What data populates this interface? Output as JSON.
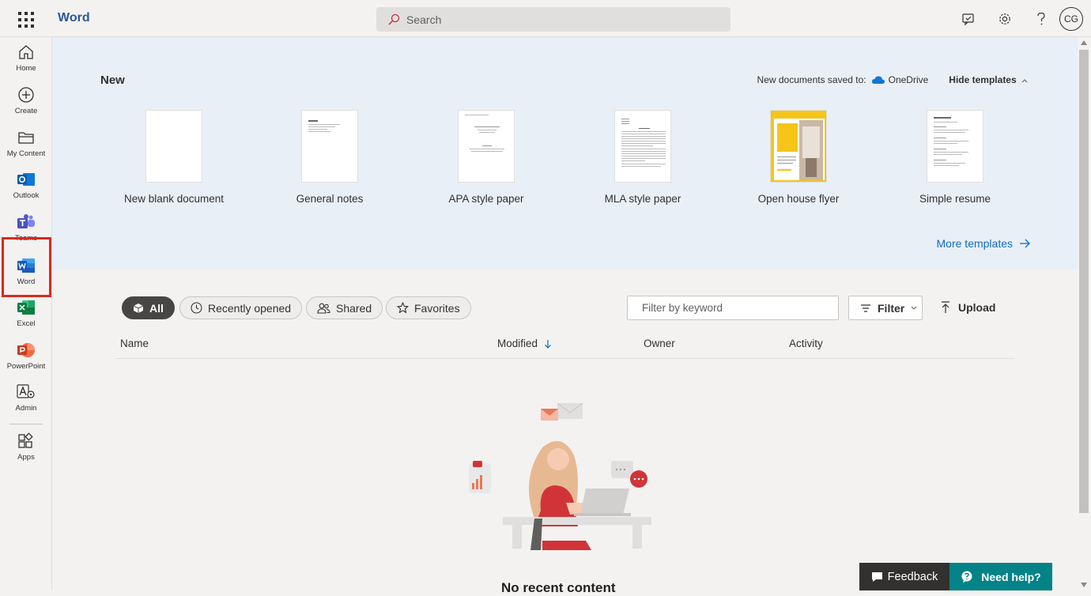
{
  "topbar": {
    "app_name": "Word",
    "search_placeholder": "Search",
    "avatar_initials": "CG"
  },
  "rail": {
    "items": [
      {
        "label": "Home",
        "icon": "home-icon"
      },
      {
        "label": "Create",
        "icon": "plus-circle-icon"
      },
      {
        "label": "My Content",
        "icon": "folder-icon"
      },
      {
        "label": "Outlook",
        "icon": "outlook-icon"
      },
      {
        "label": "Teams",
        "icon": "teams-icon"
      },
      {
        "label": "Word",
        "icon": "word-icon"
      },
      {
        "label": "Excel",
        "icon": "excel-icon"
      },
      {
        "label": "PowerPoint",
        "icon": "powerpoint-icon"
      },
      {
        "label": "Admin",
        "icon": "admin-icon"
      },
      {
        "label": "Apps",
        "icon": "apps-icon"
      }
    ]
  },
  "templates": {
    "title": "New",
    "saved_to_label": "New documents saved to:",
    "saved_to_location": "OneDrive",
    "hide_label": "Hide templates",
    "items": [
      {
        "name": "New blank document"
      },
      {
        "name": "General notes"
      },
      {
        "name": "APA style paper"
      },
      {
        "name": "MLA style paper"
      },
      {
        "name": "Open house flyer"
      },
      {
        "name": "Simple resume"
      }
    ],
    "more_label": "More templates"
  },
  "files": {
    "pills": [
      "All",
      "Recently opened",
      "Shared",
      "Favorites"
    ],
    "filter_placeholder": "Filter by keyword",
    "filter_button": "Filter",
    "upload_button": "Upload",
    "columns": [
      "Name",
      "Modified",
      "Owner",
      "Activity"
    ],
    "empty_title": "No recent content"
  },
  "footer": {
    "feedback": "Feedback",
    "need_help": "Need help?"
  },
  "colors": {
    "word_blue": "#2b579a",
    "link_blue": "#0f6cbd",
    "highlight_red": "#d62b1f",
    "help_teal": "#038387"
  }
}
